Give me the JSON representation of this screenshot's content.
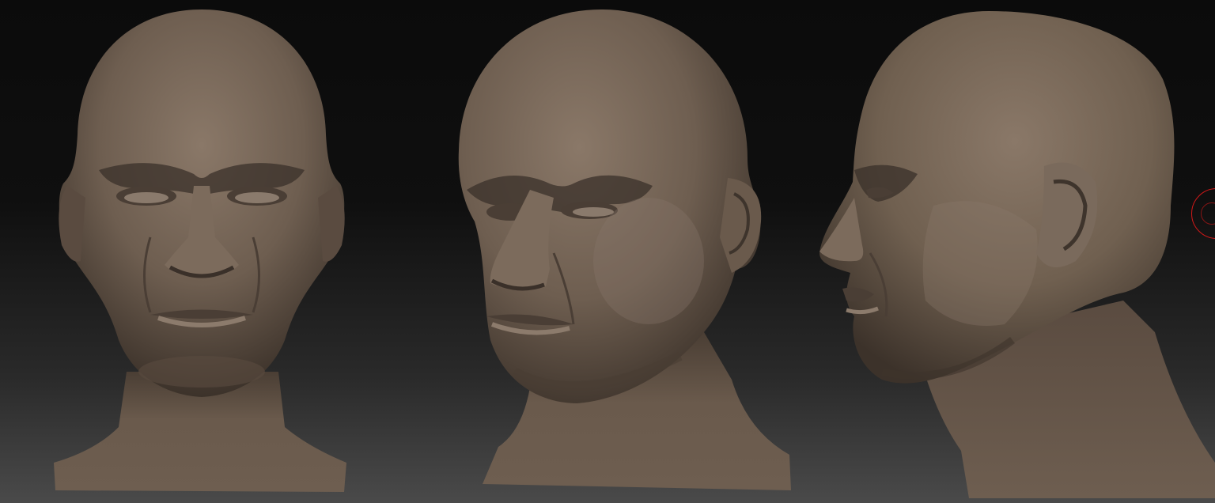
{
  "canvas": {
    "background_top": "#0b0b0b",
    "background_bottom": "#4a4a4a"
  },
  "model": {
    "material_color": "#7a6a5c",
    "shadow_color": "#3e342c",
    "highlight_color": "#a08f80",
    "views": [
      "front",
      "three-quarter",
      "profile"
    ]
  },
  "cursor": {
    "color": "#d01818",
    "icon": "brush-cursor-icon"
  }
}
